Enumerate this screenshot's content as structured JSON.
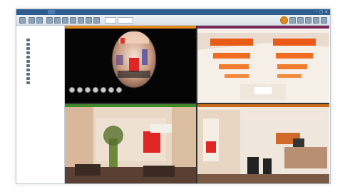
{
  "window": {
    "title": "",
    "controls": [
      "–",
      "□",
      "×"
    ]
  },
  "sidebar": {
    "tabs": [
      "",
      ""
    ],
    "root_label": "",
    "items": [
      {
        "label": ""
      },
      {
        "label": ""
      },
      {
        "label": ""
      },
      {
        "label": ""
      },
      {
        "label": ""
      },
      {
        "label": ""
      },
      {
        "label": ""
      },
      {
        "label": ""
      },
      {
        "label": ""
      },
      {
        "label": ""
      },
      {
        "label": ""
      }
    ]
  },
  "views": [
    {
      "header": "",
      "header_color": "#e38a1f"
    },
    {
      "header": "",
      "header_color": "#7a2a5a"
    },
    {
      "header": "",
      "header_color": "#3f8a2a"
    },
    {
      "header": "",
      "header_color": "#c76b1c"
    }
  ],
  "colors": {
    "title_bar": "#2d5d8f",
    "accent_orange": "#e38a1f"
  },
  "icons": [
    "minimize-icon",
    "maximize-icon",
    "close-icon",
    "camera-icon",
    "ptz-control-icon"
  ]
}
